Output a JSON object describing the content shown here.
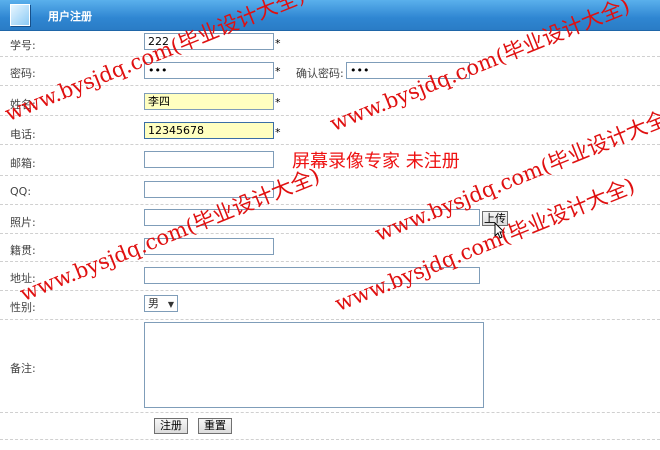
{
  "header": {
    "title": "用户注册",
    "icon": "form-icon"
  },
  "form": {
    "student_id": {
      "label": "学号:",
      "value": "222",
      "required": "*"
    },
    "password": {
      "label": "密码:",
      "value": "•••",
      "required": "*"
    },
    "confirm_password": {
      "label": "确认密码:",
      "value": "•••"
    },
    "name": {
      "label": "姓名:",
      "value": "李四",
      "required": "*"
    },
    "phone": {
      "label": "电话:",
      "value": "12345678",
      "required": "*"
    },
    "email": {
      "label": "邮箱:",
      "value": ""
    },
    "qq": {
      "label": "QQ:",
      "value": ""
    },
    "photo": {
      "label": "照片:",
      "value": "",
      "upload_label": "上传"
    },
    "hometown": {
      "label": "籍贯:",
      "value": ""
    },
    "address": {
      "label": "地址:",
      "value": ""
    },
    "gender": {
      "label": "性别:",
      "selected": "男"
    },
    "remarks": {
      "label": "备注:",
      "value": ""
    },
    "submit_label": "注册",
    "reset_label": "重置"
  },
  "watermarks": {
    "site": "www.bysjdq.com(毕业设计大全)",
    "recorder": "屏幕录像专家  未注册"
  },
  "colors": {
    "header": "#2f86d2",
    "watermark": "#e01010",
    "highlight_input": "#ffffc0"
  }
}
